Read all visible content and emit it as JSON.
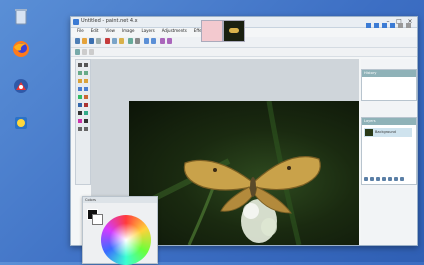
{
  "desktop": {
    "icons": [
      {
        "name": "recycle-bin",
        "label": ""
      },
      {
        "name": "firefox",
        "label": ""
      },
      {
        "name": "app",
        "label": ""
      },
      {
        "name": "app",
        "label": ""
      }
    ]
  },
  "window": {
    "title": "Untitled - paint.net 4.x",
    "menus": [
      "File",
      "Edit",
      "View",
      "Image",
      "Layers",
      "Adjustments",
      "Effects"
    ],
    "accent": "#3b7bd4"
  },
  "panels": {
    "history_title": "History",
    "layers_title": "Layers",
    "layer_name": "Background",
    "colors_title": "Colors"
  },
  "colors": {
    "primary": "#111111",
    "secondary": "#ffffff"
  }
}
